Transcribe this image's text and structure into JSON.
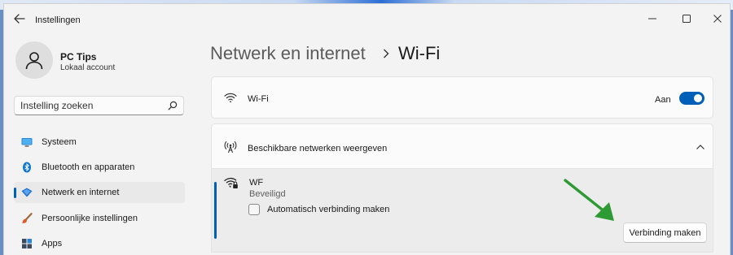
{
  "app": {
    "title": "Instellingen",
    "accent": "#005fb8"
  },
  "account": {
    "name": "PC Tips",
    "type": "Lokaal account",
    "icon": "person-icon"
  },
  "search": {
    "placeholder": "Instelling zoeken",
    "icon": "search-icon"
  },
  "sidebar": {
    "items": [
      {
        "label": "Systeem",
        "icon": "monitor-icon",
        "active": false
      },
      {
        "label": "Bluetooth en apparaten",
        "icon": "bluetooth-icon",
        "active": false
      },
      {
        "label": "Netwerk en internet",
        "icon": "network-icon",
        "active": true
      },
      {
        "label": "Persoonlijke instellingen",
        "icon": "paintbrush-icon",
        "active": false
      },
      {
        "label": "Apps",
        "icon": "apps-icon",
        "active": false
      }
    ]
  },
  "breadcrumb": {
    "parent": "Netwerk en internet",
    "current": "Wi-Fi"
  },
  "wifi": {
    "label": "Wi-Fi",
    "state": "Aan",
    "enabled": true
  },
  "available": {
    "label": "Beschikbare netwerken weergeven",
    "expanded": true
  },
  "network": {
    "name": "WF",
    "status": "Beveiligd",
    "autoconnect_label": "Automatisch verbinding maken",
    "autoconnect_checked": false,
    "connect_label": "Verbinding maken"
  },
  "annotation_color": "#2e9a34"
}
